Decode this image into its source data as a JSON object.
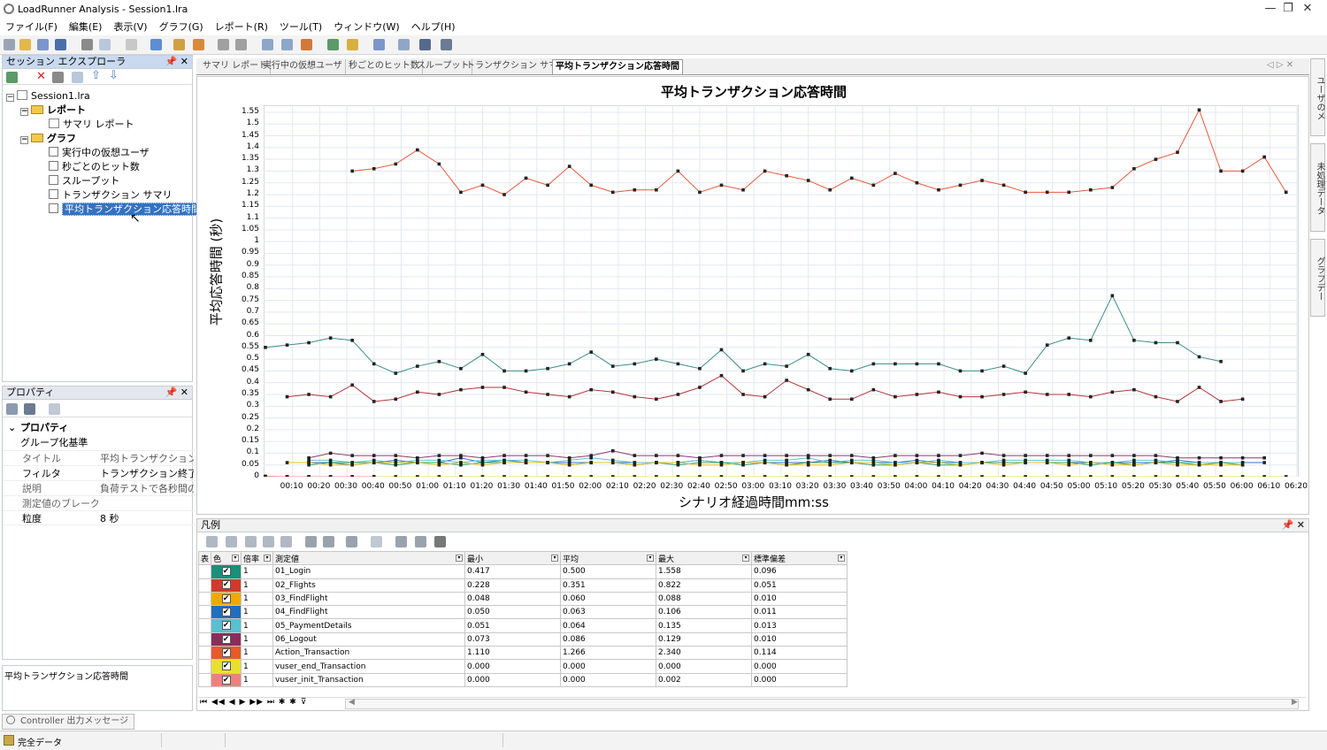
{
  "window": {
    "title": "LoadRunner Analysis - Session1.lra",
    "buttons": [
      "—",
      "❐",
      "✕"
    ]
  },
  "menu": [
    "ファイル(F)",
    "編集(E)",
    "表示(V)",
    "グラフ(G)",
    "レポート(R)",
    "ツール(T)",
    "ウィンドウ(W)",
    "ヘルプ(H)"
  ],
  "session_explorer": {
    "title": "セッション エクスプローラ",
    "root": "Session1.lra",
    "reports_folder": "レポート",
    "summary_report": "サマリ レポート",
    "graphs_folder": "グラフ",
    "graphs": [
      "実行中の仮想ユーザ",
      "秒ごとのヒット数",
      "スループット",
      "トランザクション サマリ",
      "平均トランザクション応答時間"
    ]
  },
  "properties": {
    "title": "プロパティ",
    "section": "プロパティ",
    "group_by": "グループ化基準",
    "rows": [
      {
        "key": "タイトル",
        "value": "平均トランザクション応答時間"
      },
      {
        "key": "フィルタ",
        "value": "トランザクション終了ステータス"
      },
      {
        "key": "説明",
        "value": "負荷テストで各秒間のトランザクション"
      },
      {
        "key": "測定値のブレークダウン",
        "value": ""
      },
      {
        "key": "粒度",
        "value": "8 秒"
      }
    ],
    "description": "平均トランザクション応答時間"
  },
  "tabs": [
    "サマリ レポート",
    "実行中の仮想ユーザ",
    "秒ごとのヒット数",
    "スループット",
    "トランザクション サマリ",
    "平均トランザクション応答時間"
  ],
  "right_side_tabs": [
    "ユーザのメ",
    "未処理データ",
    "グラフデー"
  ],
  "chart_data": {
    "type": "line",
    "title": "平均トランザクション応答時間",
    "xlabel": "シナリオ経過時間mm:ss",
    "ylabel": "平均応答時間 (秒)",
    "ylim": [
      0,
      1.58
    ],
    "yticks": [
      0,
      0.05,
      0.1,
      0.15,
      0.2,
      0.25,
      0.3,
      0.35,
      0.4,
      0.45,
      0.5,
      0.55,
      0.6,
      0.65,
      0.7,
      0.75,
      0.8,
      0.85,
      0.9,
      0.95,
      1,
      1.05,
      1.1,
      1.15,
      1.2,
      1.25,
      1.3,
      1.35,
      1.4,
      1.45,
      1.5,
      1.55
    ],
    "xticks": [
      "00:10",
      "00:20",
      "00:30",
      "00:40",
      "00:50",
      "01:00",
      "01:10",
      "01:20",
      "01:30",
      "01:40",
      "01:50",
      "02:00",
      "02:10",
      "02:20",
      "02:30",
      "02:40",
      "02:50",
      "03:00",
      "03:10",
      "03:20",
      "03:30",
      "03:40",
      "03:50",
      "04:00",
      "04:10",
      "04:20",
      "04:30",
      "04:40",
      "04:50",
      "05:00",
      "05:10",
      "05:20",
      "05:30",
      "05:40",
      "05:50",
      "06:00",
      "06:10",
      "06:20"
    ],
    "x_start_sec": 0,
    "x_step_sec": 8,
    "grid": true,
    "series": [
      {
        "color": "#e8593c",
        "start": 4,
        "values": [
          1.3,
          1.31,
          1.33,
          1.39,
          1.33,
          1.21,
          1.24,
          1.2,
          1.27,
          1.24,
          1.32,
          1.24,
          1.21,
          1.22,
          1.22,
          1.3,
          1.21,
          1.24,
          1.22,
          1.3,
          1.28,
          1.26,
          1.22,
          1.27,
          1.24,
          1.29,
          1.25,
          1.22,
          1.24,
          1.26,
          1.24,
          1.21,
          1.21,
          1.21,
          1.22,
          1.23,
          1.31,
          1.35,
          1.38,
          1.56,
          1.3,
          1.3,
          1.36,
          1.21,
          1.26
        ]
      },
      {
        "color": "#3a8f8a",
        "start": 0,
        "values": [
          0.55,
          0.56,
          0.57,
          0.59,
          0.58,
          0.48,
          0.44,
          0.47,
          0.49,
          0.46,
          0.52,
          0.45,
          0.45,
          0.46,
          0.48,
          0.53,
          0.47,
          0.48,
          0.5,
          0.48,
          0.46,
          0.54,
          0.45,
          0.48,
          0.47,
          0.52,
          0.46,
          0.45,
          0.48,
          0.48,
          0.48,
          0.48,
          0.45,
          0.45,
          0.47,
          0.44,
          0.56,
          0.59,
          0.58,
          0.77,
          0.58,
          0.57,
          0.57,
          0.51,
          0.49
        ]
      },
      {
        "color": "#b5363c",
        "start": 1,
        "values": [
          0.34,
          0.35,
          0.34,
          0.39,
          0.32,
          0.33,
          0.36,
          0.35,
          0.37,
          0.38,
          0.38,
          0.36,
          0.35,
          0.34,
          0.37,
          0.36,
          0.34,
          0.33,
          0.35,
          0.38,
          0.43,
          0.35,
          0.34,
          0.41,
          0.37,
          0.33,
          0.33,
          0.37,
          0.34,
          0.35,
          0.36,
          0.34,
          0.34,
          0.35,
          0.36,
          0.35,
          0.35,
          0.34,
          0.36,
          0.37,
          0.34,
          0.32,
          0.38,
          0.32,
          0.33
        ]
      },
      {
        "color": "#8b3a6b",
        "start": 2,
        "values": [
          0.08,
          0.1,
          0.09,
          0.09,
          0.09,
          0.08,
          0.09,
          0.09,
          0.08,
          0.09,
          0.09,
          0.09,
          0.08,
          0.09,
          0.11,
          0.09,
          0.09,
          0.09,
          0.08,
          0.09,
          0.09,
          0.09,
          0.09,
          0.09,
          0.09,
          0.09,
          0.08,
          0.09,
          0.09,
          0.09,
          0.09,
          0.1,
          0.09,
          0.09,
          0.09,
          0.09,
          0.09,
          0.09,
          0.09,
          0.09,
          0.08,
          0.08,
          0.08,
          0.08,
          0.08
        ]
      },
      {
        "color": "#2e75c8",
        "start": 2,
        "values": [
          0.06,
          0.06,
          0.05,
          0.06,
          0.07,
          0.06,
          0.06,
          0.08,
          0.06,
          0.07,
          0.06,
          0.06,
          0.06,
          0.06,
          0.06,
          0.06,
          0.06,
          0.06,
          0.07,
          0.06,
          0.06,
          0.06,
          0.06,
          0.06,
          0.07,
          0.06,
          0.06,
          0.06,
          0.07,
          0.06,
          0.06,
          0.06,
          0.06,
          0.06,
          0.06,
          0.06,
          0.06,
          0.06,
          0.06,
          0.06,
          0.07,
          0.06,
          0.06,
          0.06,
          0.06
        ]
      },
      {
        "color": "#5bc3d6",
        "start": 2,
        "values": [
          0.07,
          0.07,
          0.06,
          0.07,
          0.06,
          0.07,
          0.07,
          0.06,
          0.07,
          0.07,
          0.07,
          0.06,
          0.07,
          0.08,
          0.07,
          0.06,
          0.06,
          0.06,
          0.07,
          0.06,
          0.06,
          0.07,
          0.07,
          0.08,
          0.06,
          0.07,
          0.07,
          0.06,
          0.06,
          0.07,
          0.06,
          0.06,
          0.07,
          0.07,
          0.07,
          0.07,
          0.06,
          0.06,
          0.07,
          0.07,
          0.06,
          0.06,
          0.06,
          0.06
        ]
      },
      {
        "color": "#3aa35a",
        "start": 2,
        "values": [
          0.05,
          0.06,
          0.06,
          0.06,
          0.05,
          0.06,
          0.06,
          0.05,
          0.06,
          0.06,
          0.06,
          0.06,
          0.05,
          0.06,
          0.06,
          0.05,
          0.06,
          0.05,
          0.06,
          0.06,
          0.05,
          0.06,
          0.05,
          0.06,
          0.06,
          0.06,
          0.05,
          0.05,
          0.06,
          0.05,
          0.05,
          0.06,
          0.06,
          0.06,
          0.06,
          0.06,
          0.05,
          0.06,
          0.05,
          0.06,
          0.06,
          0.05,
          0.06,
          0.05
        ]
      },
      {
        "color": "#e8c21a",
        "start": 1,
        "values": [
          0.06,
          0.06,
          0.05,
          0.05,
          0.06,
          0.06,
          0.06,
          0.05,
          0.06,
          0.05,
          0.06,
          0.06,
          0.06,
          0.05,
          0.06,
          0.06,
          0.05,
          0.06,
          0.06,
          0.05,
          0.05,
          0.06,
          0.06,
          0.05,
          0.05,
          0.05,
          0.06,
          0.06,
          0.05,
          0.06,
          0.06,
          0.05,
          0.06,
          0.05,
          0.06,
          0.06,
          0.05,
          0.06,
          0.05,
          0.05,
          0.06,
          0.05,
          0.05,
          0.05,
          0.05
        ]
      },
      {
        "color": "#e0e040",
        "start": 0,
        "values": [
          0,
          0,
          0,
          0,
          0,
          0,
          0,
          0,
          0,
          0,
          0,
          0,
          0,
          0,
          0,
          0,
          0,
          0,
          0,
          0,
          0,
          0,
          0,
          0,
          0,
          0,
          0,
          0,
          0,
          0,
          0,
          0,
          0,
          0,
          0,
          0,
          0,
          0,
          0,
          0,
          0,
          0,
          0,
          0,
          0,
          0,
          0,
          0
        ]
      },
      {
        "color": "#f08080",
        "start": 0,
        "values": [
          0.002,
          0,
          0,
          0,
          0,
          0
        ]
      }
    ]
  },
  "legend": {
    "title": "凡例",
    "headers": [
      "表",
      "色",
      "倍率",
      "測定値",
      "最小",
      "平均",
      "最大",
      "標準偏差"
    ],
    "rows": [
      {
        "color": "#1a8f7a",
        "scale": "1",
        "name": "01_Login",
        "min": "0.417",
        "avg": "0.500",
        "max": "1.558",
        "std": "0.096"
      },
      {
        "color": "#d03a2a",
        "scale": "1",
        "name": "02_Flights",
        "min": "0.228",
        "avg": "0.351",
        "max": "0.822",
        "std": "0.051"
      },
      {
        "color": "#f0a800",
        "scale": "1",
        "name": "03_FindFlight",
        "min": "0.048",
        "avg": "0.060",
        "max": "0.088",
        "std": "0.010"
      },
      {
        "color": "#1f6fbf",
        "scale": "1",
        "name": "04_FindFlight",
        "min": "0.050",
        "avg": "0.063",
        "max": "0.106",
        "std": "0.011"
      },
      {
        "color": "#59c0d0",
        "scale": "1",
        "name": "05_PaymentDetails",
        "min": "0.051",
        "avg": "0.064",
        "max": "0.135",
        "std": "0.013"
      },
      {
        "color": "#8b2d5a",
        "scale": "1",
        "name": "06_Logout",
        "min": "0.073",
        "avg": "0.086",
        "max": "0.129",
        "std": "0.010"
      },
      {
        "color": "#e85a2a",
        "scale": "1",
        "name": "Action_Transaction",
        "min": "1.110",
        "avg": "1.266",
        "max": "2.340",
        "std": "0.114"
      },
      {
        "color": "#e8e030",
        "scale": "1",
        "name": "vuser_end_Transaction",
        "min": "0.000",
        "avg": "0.000",
        "max": "0.000",
        "std": "0.000"
      },
      {
        "color": "#f08080",
        "scale": "1",
        "name": "vuser_init_Transaction",
        "min": "0.000",
        "avg": "0.000",
        "max": "0.002",
        "std": "0.000"
      }
    ]
  },
  "bottom": {
    "output_tab": "Controller 出力メッセージ",
    "status": "完全データ"
  }
}
